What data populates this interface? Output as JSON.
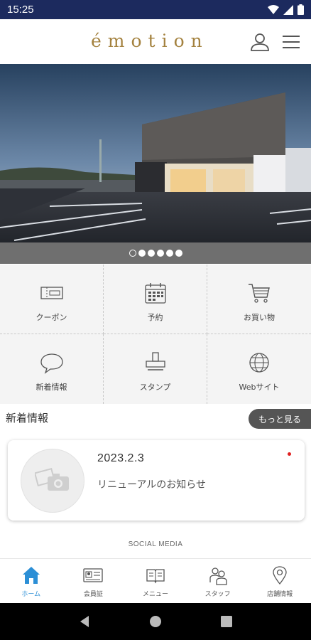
{
  "status_bar": {
    "time": "15:25"
  },
  "header": {
    "logo_text": "émotion",
    "user_icon": "user-icon",
    "menu_icon": "hamburger-menu-icon"
  },
  "hero": {
    "slide_count": 6,
    "active_slide": 1
  },
  "menu_grid": [
    {
      "label": "クーポン",
      "icon": "coupon-icon"
    },
    {
      "label": "予約",
      "icon": "calendar-icon"
    },
    {
      "label": "お買い物",
      "icon": "cart-icon"
    },
    {
      "label": "新着情報",
      "icon": "speech-bubble-icon"
    },
    {
      "label": "スタンプ",
      "icon": "stamp-icon"
    },
    {
      "label": "Webサイト",
      "icon": "globe-icon"
    }
  ],
  "news": {
    "section_title": "新着情報",
    "more_button": "もっと見る",
    "items": [
      {
        "date": "2023.2.3",
        "title": "リニューアルのお知らせ",
        "is_new": true
      }
    ]
  },
  "social_label": "SOCIAL MEDIA",
  "bottom_nav": [
    {
      "label": "ホーム",
      "icon": "home-icon",
      "active": true
    },
    {
      "label": "会員証",
      "icon": "member-card-icon"
    },
    {
      "label": "メニュー",
      "icon": "menu-book-icon"
    },
    {
      "label": "スタッフ",
      "icon": "staff-icon"
    },
    {
      "label": "店舗情報",
      "icon": "location-pin-icon"
    }
  ],
  "colors": {
    "status_bar": "#1c2a5e",
    "logo": "#a4823f",
    "active_tab": "#2c8fd6",
    "new_dot": "#e02020"
  }
}
